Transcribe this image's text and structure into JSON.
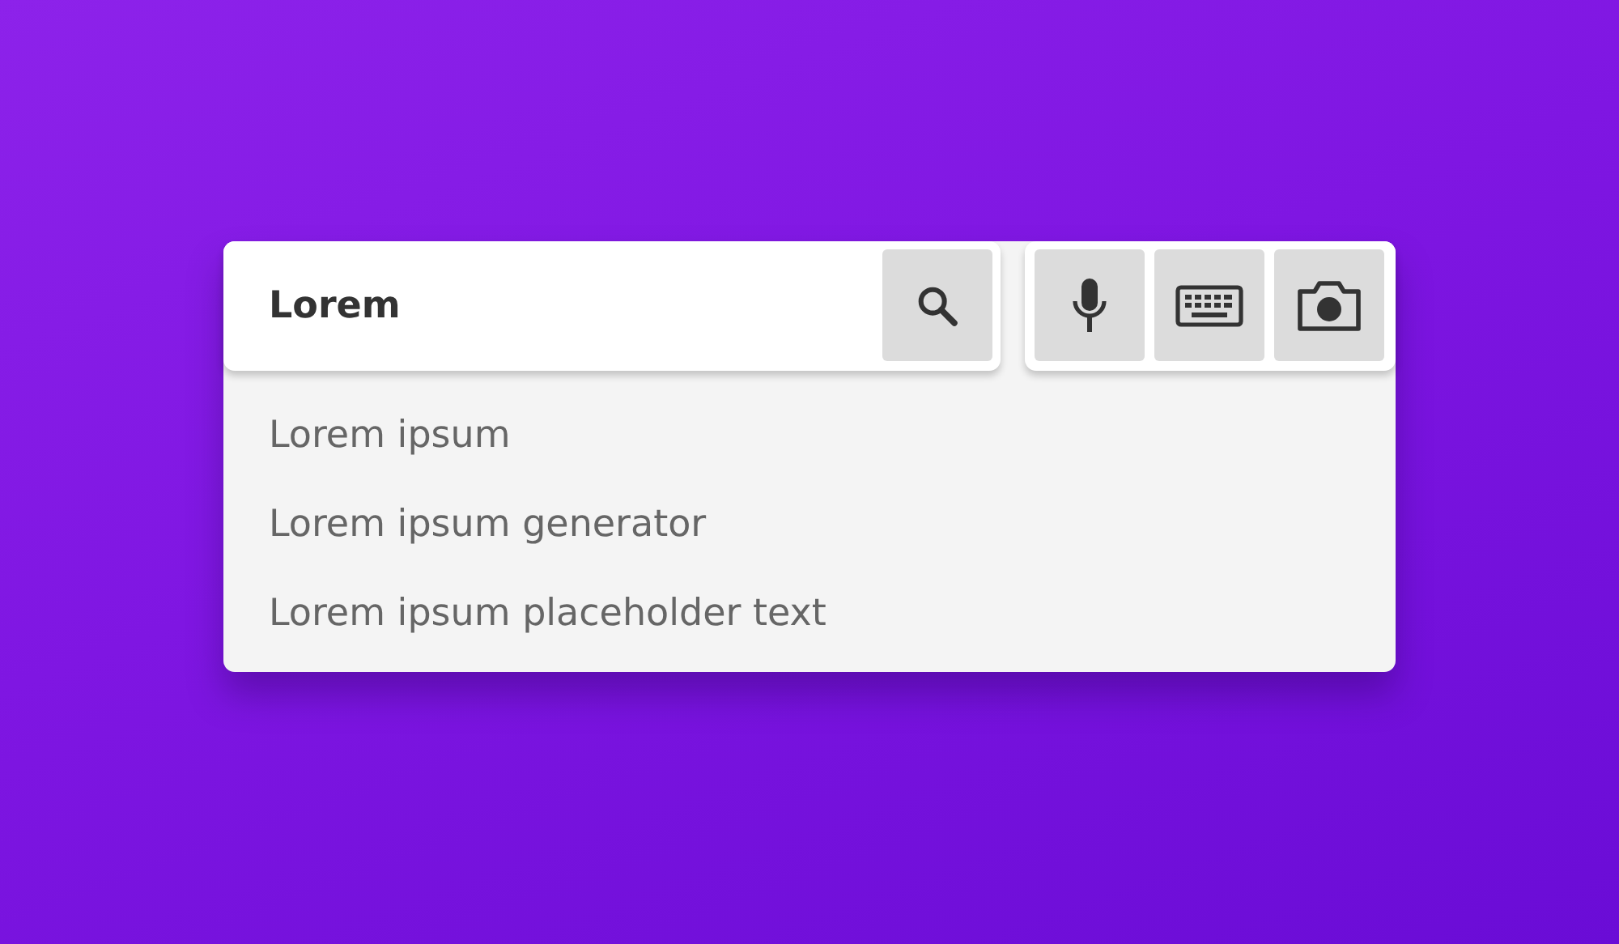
{
  "search": {
    "value": "Lorem"
  },
  "suggestions": [
    "Lorem ipsum",
    "Lorem ipsum generator",
    "Lorem ipsum placeholder text"
  ]
}
